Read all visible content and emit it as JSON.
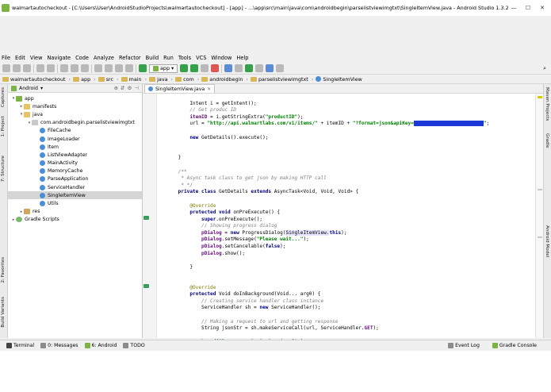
{
  "window": {
    "title": "walmartautocheckout - [C:\\Users\\User\\AndroidStudioProjects\\walmartautocheckout] - [app] - ...\\app\\src\\main\\java\\com\\androidbegin\\parselistviewimgtxt\\SingleItemView.java - Android Studio 1.3.2",
    "minimize": "—",
    "maximize": "☐",
    "close": "✕"
  },
  "menu": [
    "File",
    "Edit",
    "View",
    "Navigate",
    "Code",
    "Analyze",
    "Refactor",
    "Build",
    "Run",
    "Tools",
    "VCS",
    "Window",
    "Help"
  ],
  "toolbar": {
    "run_config": "app"
  },
  "breadcrumb": [
    "walmartautocheckout",
    "app",
    "src",
    "main",
    "java",
    "com",
    "androidbegin",
    "parselistviewimgtxt",
    "SingleItemView"
  ],
  "left_tabs": [
    "1: Project",
    "7: Structure",
    "Captures",
    "2: Favorites",
    "Build Variants"
  ],
  "right_tabs": [
    "Maven Projects",
    "Gradle",
    "Android Model"
  ],
  "project_panel": {
    "view": "Android",
    "tree": [
      {
        "label": "app",
        "level": 0,
        "icon": "app-folder-icon",
        "arrow": "▾"
      },
      {
        "label": "manifests",
        "level": 1,
        "icon": "folder-icon",
        "arrow": "▸"
      },
      {
        "label": "java",
        "level": 1,
        "icon": "folder-icon",
        "arrow": "▾"
      },
      {
        "label": "com.androidbegin.parselistviewimgtxt",
        "level": 2,
        "icon": "package-icon",
        "arrow": "▾"
      },
      {
        "label": "FileCache",
        "level": 3,
        "icon": "class-icon",
        "arrow": ""
      },
      {
        "label": "ImageLoader",
        "level": 3,
        "icon": "class-icon",
        "arrow": ""
      },
      {
        "label": "Item",
        "level": 3,
        "icon": "class-icon",
        "arrow": ""
      },
      {
        "label": "ListViewAdapter",
        "level": 3,
        "icon": "class-icon",
        "arrow": ""
      },
      {
        "label": "MainActivity",
        "level": 3,
        "icon": "class-icon",
        "arrow": ""
      },
      {
        "label": "MemoryCache",
        "level": 3,
        "icon": "class-icon",
        "arrow": ""
      },
      {
        "label": "ParseApplication",
        "level": 3,
        "icon": "class-icon",
        "arrow": ""
      },
      {
        "label": "ServiceHandler",
        "level": 3,
        "icon": "class-icon",
        "arrow": ""
      },
      {
        "label": "SingleItemView",
        "level": 3,
        "icon": "class-icon",
        "arrow": "",
        "selected": true
      },
      {
        "label": "Utils",
        "level": 3,
        "icon": "class-icon",
        "arrow": ""
      },
      {
        "label": "res",
        "level": 1,
        "icon": "res-folder-icon",
        "arrow": "▸"
      },
      {
        "label": "Gradle Scripts",
        "level": 0,
        "icon": "gradle-icon",
        "arrow": "▸"
      }
    ]
  },
  "editor": {
    "tab_label": "SingleItemView.java",
    "lines": [
      [],
      [
        [
          "t",
          "        Intent i = getIntent();"
        ]
      ],
      [
        [
          "c",
          "        // Get produc ID"
        ]
      ],
      [
        [
          "f",
          "        itemID"
        ],
        [
          "t",
          " = i.getStringExtra("
        ],
        [
          "s",
          "\"productID\""
        ],
        [
          "t",
          ");"
        ]
      ],
      [
        [
          "t",
          "        url = "
        ],
        [
          "s",
          "\"http://api.walmartlabs.com/v1/items/\""
        ],
        [
          "t",
          " + itemID + "
        ],
        [
          "s",
          "\"?format=json&apiKey="
        ],
        [
          "r",
          "xxxxxxxxxxxxxxxxxxxxxxxx"
        ],
        [
          "s",
          "\""
        ],
        [
          "t",
          ";"
        ]
      ],
      [],
      [
        [
          "k",
          "        new "
        ],
        [
          "t",
          "GetDetails().execute();"
        ]
      ],
      [],
      [],
      [
        [
          "t",
          "    }"
        ]
      ],
      [],
      [
        [
          "c",
          "    /**"
        ]
      ],
      [
        [
          "c",
          "     * Async task class to get json by making HTTP call"
        ]
      ],
      [
        [
          "c",
          "     * */"
        ]
      ],
      [
        [
          "k",
          "    private class "
        ],
        [
          "t",
          "GetDetails "
        ],
        [
          "k",
          "extends "
        ],
        [
          "t",
          "AsyncTask<Void, Void, Void> {"
        ]
      ],
      [],
      [
        [
          "a",
          "        @Override"
        ]
      ],
      [
        [
          "k",
          "        protected void "
        ],
        [
          "t",
          "onPreExecute() {"
        ]
      ],
      [
        [
          "k",
          "            super"
        ],
        [
          "t",
          ".onPreExecute();"
        ]
      ],
      [
        [
          "c",
          "            // Showing progress dialog"
        ]
      ],
      [
        [
          "f",
          "            pDialog"
        ],
        [
          "t",
          " = "
        ],
        [
          "k",
          "new "
        ],
        [
          "t",
          "ProgressDialog("
        ],
        [
          "h",
          "SingleItemView."
        ],
        [
          "k",
          "this"
        ],
        [
          "t",
          ");"
        ]
      ],
      [
        [
          "f",
          "            pDialog"
        ],
        [
          "t",
          ".setMessage("
        ],
        [
          "s",
          "\"Please wait...\""
        ],
        [
          "t",
          ");"
        ]
      ],
      [
        [
          "f",
          "            pDialog"
        ],
        [
          "t",
          ".setCancelable("
        ],
        [
          "k",
          "false"
        ],
        [
          "t",
          ");"
        ]
      ],
      [
        [
          "f",
          "            pDialog"
        ],
        [
          "t",
          ".show();"
        ]
      ],
      [],
      [
        [
          "t",
          "        }"
        ]
      ],
      [],
      [],
      [
        [
          "a",
          "        @Override"
        ]
      ],
      [
        [
          "k",
          "        protected "
        ],
        [
          "t",
          "Void doInBackground(Void... arg0) {"
        ]
      ],
      [
        [
          "c",
          "            // Creating service handler class instance"
        ]
      ],
      [
        [
          "t",
          "            ServiceHandler sh = "
        ],
        [
          "k",
          "new "
        ],
        [
          "t",
          "ServiceHandler();"
        ]
      ],
      [],
      [
        [
          "c",
          "            // Making a request to url and getting response"
        ]
      ],
      [
        [
          "t",
          "            String jsonStr = sh.makeServiceCall(url, ServiceHandler."
        ],
        [
          "f",
          "GET"
        ],
        [
          "t",
          ");"
        ]
      ],
      [],
      [
        [
          "t",
          "            Log.d("
        ],
        [
          "s",
          "\"Response: \""
        ],
        [
          "t",
          ", "
        ],
        [
          "s",
          "\"> \""
        ],
        [
          "t",
          " + jsonStr);"
        ]
      ]
    ]
  },
  "statusbar": {
    "left": [
      {
        "label": "Terminal",
        "icon": "terminal-icon"
      },
      {
        "label": "0: Messages",
        "icon": "messages-icon"
      },
      {
        "label": "6: Android",
        "icon": "android-icon"
      },
      {
        "label": "TODO",
        "icon": "todo-icon"
      }
    ],
    "right": [
      {
        "label": "Event Log",
        "icon": "event-log-icon"
      },
      {
        "label": "Gradle Console",
        "icon": "gradle-console-icon"
      }
    ]
  }
}
